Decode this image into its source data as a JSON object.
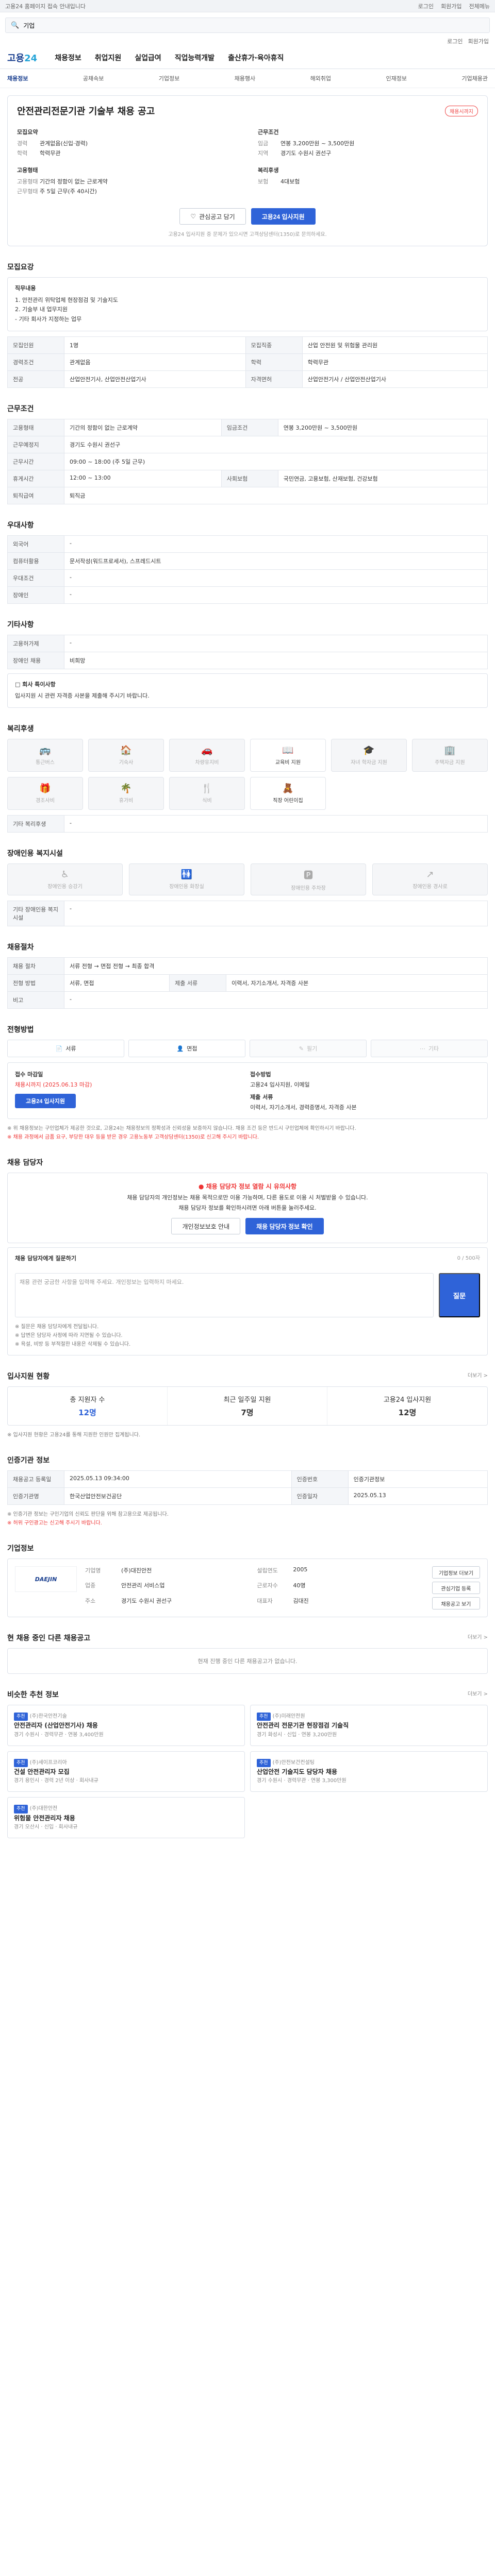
{
  "topbar": {
    "text": "고용24 홈페이지 접속 안내입니다",
    "links": [
      "로그인",
      "회원가입",
      "전체메뉴"
    ]
  },
  "search": {
    "placeholder": "검색어를 입력하세요",
    "keyword": "기업"
  },
  "util": [
    "로그인",
    "회원가입"
  ],
  "logo": {
    "a": "고용",
    "b": "24"
  },
  "gnb": [
    "채용정보",
    "취업지원",
    "실업급여",
    "직업능력개발",
    "출산휴가·육아휴직"
  ],
  "subnav": [
    "채용정보",
    "공채속보",
    "기업정보",
    "채용행사",
    "해외취업",
    "인재정보",
    "기업채용관"
  ],
  "job": {
    "title": "안전관리전문기관 기술부 채용 공고",
    "status": "채용시까지",
    "recruit_title": "모집요약",
    "recruit": [
      {
        "k": "경력",
        "v": "관계없음(신입·경력)"
      },
      {
        "k": "학력",
        "v": "학력무관"
      }
    ],
    "cond_title": "근무조건",
    "cond": [
      {
        "k": "임금",
        "v": "연봉 3,200만원 ~ 3,500만원"
      },
      {
        "k": "지역",
        "v": "경기도 수원시 권선구"
      }
    ],
    "emp_title": "고용형태",
    "emp": [
      {
        "k": "고용형태",
        "v": "기간의 정함이 없는 근로계약"
      },
      {
        "k": "근무형태",
        "v": "주 5일 근무(주 40시간)"
      }
    ],
    "etc_title": "복리후생",
    "etc": [
      {
        "k": "보험",
        "v": "4대보험"
      }
    ],
    "btn_scrap": "관심공고 담기",
    "btn_apply": "고용24 입사지원",
    "note": "고용24 입사지원 중 문제가 있으시면 고객상담센터(1350)로 문의하세요."
  },
  "s1": {
    "h": "모집요강",
    "box_title": "직무내용",
    "box_lines": [
      "1. 안전관리 위탁업체 현장점검 및 기술지도",
      "2. 기술부 내 업무지원",
      "- 기타 회사가 지정하는 업무"
    ],
    "rows": [
      {
        "k": "모집인원",
        "v": "1명"
      },
      {
        "k": "모집직종",
        "v": "산업 안전원 및 위험물 관리원"
      },
      {
        "k": "경력조건",
        "v": "관계없음"
      },
      {
        "k": "학력",
        "v": "학력무관"
      },
      {
        "k": "전공",
        "v": "산업안전기사, 산업안전산업기사"
      },
      {
        "k": "자격면허",
        "v": "산업안전기사 / 산업안전산업기사"
      }
    ]
  },
  "s2": {
    "h": "근무조건",
    "rows": [
      {
        "k": "고용형태",
        "v": "기간의 정함이 없는 근로계약"
      },
      {
        "k": "임금조건",
        "v": "연봉 3,200만원 ~ 3,500만원"
      },
      {
        "k": "근무예정지",
        "v": "경기도 수원시 권선구"
      },
      {
        "k": "근무시간",
        "v": "09:00 ~ 18:00 (주 5일 근무)"
      },
      {
        "k": "휴게시간",
        "v": "12:00 ~ 13:00"
      },
      {
        "k": "사회보험",
        "v": "국민연금, 고용보험, 산재보험, 건강보험"
      },
      {
        "k": "퇴직급여",
        "v": "퇴직금"
      }
    ]
  },
  "s3": {
    "h": "우대사항",
    "rows": [
      {
        "k": "외국어",
        "v": "-"
      },
      {
        "k": "컴퓨터활용",
        "v": "문서작성(워드프로세서), 스프레드시트"
      },
      {
        "k": "우대조건",
        "v": "-"
      },
      {
        "k": "장애인",
        "v": "-"
      }
    ]
  },
  "s4": {
    "h": "기타사항",
    "rows": [
      {
        "k": "고용허가제",
        "v": "-"
      },
      {
        "k": "장애인 채용",
        "v": "비희망"
      }
    ],
    "note_title": "□ 회사 특이사항",
    "note": "입사지원 시 관련 자격증 사본을 제출해 주시기 바랍니다."
  },
  "s5": {
    "h": "복리후생",
    "items": [
      {
        "label": "통근버스",
        "on": false,
        "icon": "🚌"
      },
      {
        "label": "기숙사",
        "on": false,
        "icon": "🏠"
      },
      {
        "label": "차량유지비",
        "on": false,
        "icon": "🚗"
      },
      {
        "label": "교육비 지원",
        "on": true,
        "icon": "📖"
      },
      {
        "label": "자녀 학자금 지원",
        "on": false,
        "icon": "🎓"
      },
      {
        "label": "주택자금 지원",
        "on": false,
        "icon": "🏢"
      },
      {
        "label": "경조사비",
        "on": false,
        "icon": "🎁"
      },
      {
        "label": "휴가비",
        "on": false,
        "icon": "🌴"
      },
      {
        "label": "식비",
        "on": false,
        "icon": "🍴"
      },
      {
        "label": "직장 어린이집",
        "on": true,
        "icon": "🧸"
      }
    ],
    "etc_k": "기타 복리후생",
    "etc_v": "-"
  },
  "s6": {
    "h": "장애인용 복지시설",
    "items": [
      {
        "label": "장애인용 승강기",
        "icon": "♿"
      },
      {
        "label": "장애인용 화장실",
        "icon": "🚻"
      },
      {
        "label": "장애인용 주차장",
        "icon": "🅿"
      },
      {
        "label": "장애인용 경사로",
        "icon": "↗"
      }
    ],
    "etc_k": "기타 장애인용 복지시설",
    "etc_v": "-"
  },
  "s7": {
    "h": "채용절차",
    "rows": [
      {
        "k": "채용 절차",
        "v": "서류 전형 → 면접 전형 → 최종 합격"
      },
      {
        "k": "전형 방법",
        "v": "서류, 면접"
      },
      {
        "k": "제출 서류",
        "v": "이력서, 자기소개서, 자격증 사본"
      },
      {
        "k": "비고",
        "v": "-"
      }
    ]
  },
  "s8": {
    "h": "전형방법",
    "tabs": [
      {
        "label": "서류",
        "off": false
      },
      {
        "label": "면접",
        "off": false
      },
      {
        "label": "필기",
        "off": true
      },
      {
        "label": "기타",
        "off": true
      }
    ],
    "left_title": "접수 마감일",
    "left_v": "채용시까지 (2025.06.13 마감)",
    "right_title": "접수방법",
    "right_v": "고용24 입사지원, 이메일",
    "right_title2": "제출 서류",
    "right_v2": "이력서, 자기소개서, 경력증명서, 자격증 사본",
    "apply_btn": "고용24 입사지원",
    "notice": "※ 위 채용정보는 구인업체가 제공한 것으로, 고용24는 채용정보의 정확성과 신뢰성을 보증하지 않습니다. 채용 조건 등은 반드시 구인업체에 확인하시기 바랍니다.",
    "notice_red": "※ 채용 과정에서 금품 요구, 부당한 대우 등을 받은 경우 고용노동부 고객상담센터(1350)로 신고해 주시기 바랍니다."
  },
  "s9": {
    "h": "채용 담당자",
    "alert": "채용 담당자 정보 열람 시 유의사항",
    "desc1": "채용 담당자의 개인정보는 채용 목적으로만 이용 가능하며, 다른 용도로 이용 시 처벌받을 수 있습니다.",
    "desc2": "채용 담당자 정보를 확인하시려면 아래 버튼을 눌러주세요.",
    "btn1": "개인정보보호 안내",
    "btn2": "채용 담당자 정보 확인",
    "q_title": "채용 담당자에게 질문하기",
    "q_counter": "0 / 500자",
    "q_placeholder": "채용 관련 궁금한 사항을 입력해 주세요. 개인정보는 입력하지 마세요.",
    "q_btn": "질문",
    "q_notes": [
      "※ 질문은 채용 담당자에게 전달됩니다.",
      "※ 답변은 담당자 사정에 따라 지연될 수 있습니다.",
      "※ 욕설, 비방 등 부적절한 내용은 삭제될 수 있습니다."
    ]
  },
  "s10": {
    "h": "입사지원 현황",
    "more": "더보기 >",
    "items": [
      {
        "k": "총 지원자 수",
        "v": "12명"
      },
      {
        "k": "최근 일주일 지원",
        "v": "7명"
      },
      {
        "k": "고용24 입사지원",
        "v": "12명"
      }
    ],
    "note": "※ 입사지원 현황은 고용24를 통해 지원한 인원만 집계됩니다."
  },
  "s11": {
    "h": "인증기관 정보",
    "rows": [
      {
        "k": "채용공고 등록일",
        "v": "2025.05.13 09:34:00",
        "k2": "인증번호",
        "v2": "인증기관정보"
      },
      {
        "k": "인증기관명",
        "v": "한국산업안전보건공단",
        "k2": "인증일자",
        "v2": "2025.05.13"
      }
    ],
    "notice": "※ 인증기관 정보는 구인기업의 신뢰도 판단을 위해 참고용으로 제공됩니다.",
    "notice_red": "※ 허위 구인광고는 신고해 주시기 바랍니다."
  },
  "s12": {
    "h": "기업정보",
    "logo": "DAEJIN",
    "rows": [
      {
        "k": "기업명",
        "v": "(주)대진안전"
      },
      {
        "k": "설립연도",
        "v": "2005"
      },
      {
        "k": "업종",
        "v": "안전관리 서비스업"
      },
      {
        "k": "근로자수",
        "v": "40명"
      },
      {
        "k": "주소",
        "v": "경기도 수원시 권선구"
      },
      {
        "k": "대표자",
        "v": "김대진"
      }
    ],
    "btns": [
      "기업정보 더보기",
      "관심기업 등록",
      "채용공고 보기"
    ]
  },
  "s13": {
    "h": "현 채용 중인 다른 채용공고",
    "more": "더보기 >",
    "empty": "현재 진행 중인 다른 채용공고가 없습니다."
  },
  "s14": {
    "h": "비슷한 추천 정보",
    "more": "더보기 >",
    "items": [
      {
        "tag": "추천",
        "co": "(주)한국안전기술",
        "title": "안전관리자 (산업안전기사) 채용",
        "sub": "경기 수원시 · 경력무관 · 연봉 3,400만원"
      },
      {
        "tag": "추천",
        "co": "(주)미래안전원",
        "title": "안전관리 전문기관 현장점검 기술직",
        "sub": "경기 화성시 · 신입 · 연봉 3,200만원"
      },
      {
        "tag": "추천",
        "co": "(주)세이프코리아",
        "title": "건설 안전관리자 모집",
        "sub": "경기 용인시 · 경력 2년 이상 · 회사내규"
      },
      {
        "tag": "추천",
        "co": "(주)안전보건컨설팅",
        "title": "산업안전 기술지도 담당자 채용",
        "sub": "경기 수원시 · 경력무관 · 연봉 3,300만원"
      },
      {
        "tag": "추천",
        "co": "(주)대한안전",
        "title": "위험물 안전관리자 채용",
        "sub": "경기 오산시 · 신입 · 회사내규"
      }
    ]
  }
}
